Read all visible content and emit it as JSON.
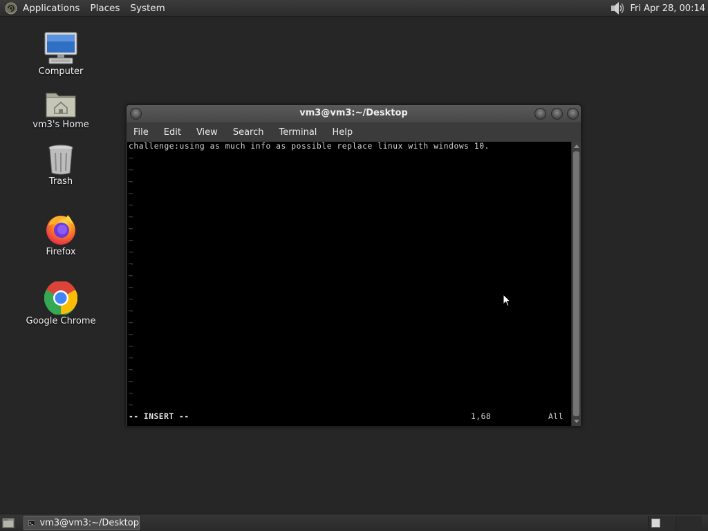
{
  "top_panel": {
    "menus": [
      "Applications",
      "Places",
      "System"
    ],
    "clock": "Fri Apr 28, 00:14",
    "volume_icon": "speaker-icon"
  },
  "desktop_icons": [
    {
      "label": "Computer",
      "icon": "computer-icon"
    },
    {
      "label": "vm3's Home",
      "icon": "home-folder-icon"
    },
    {
      "label": "Trash",
      "icon": "trash-icon"
    },
    {
      "label": "Firefox",
      "icon": "firefox-icon"
    },
    {
      "label": "Google Chrome",
      "icon": "chrome-icon"
    }
  ],
  "window": {
    "title": "vm3@vm3:~/Desktop",
    "menus": [
      "File",
      "Edit",
      "View",
      "Search",
      "Terminal",
      "Help"
    ],
    "content_lines": [
      "challenge:using as much info as possible replace linux with windows 10."
    ],
    "tilde": "~",
    "mode": "-- INSERT --",
    "cursor_pos": "1,68",
    "scroll_pos": "All"
  },
  "taskbar": {
    "task_label": "vm3@vm3:~/Desktop"
  },
  "colors": {
    "desktop_bg": "#262626",
    "panel_bg": "#333333",
    "terminal_bg": "#000000"
  }
}
